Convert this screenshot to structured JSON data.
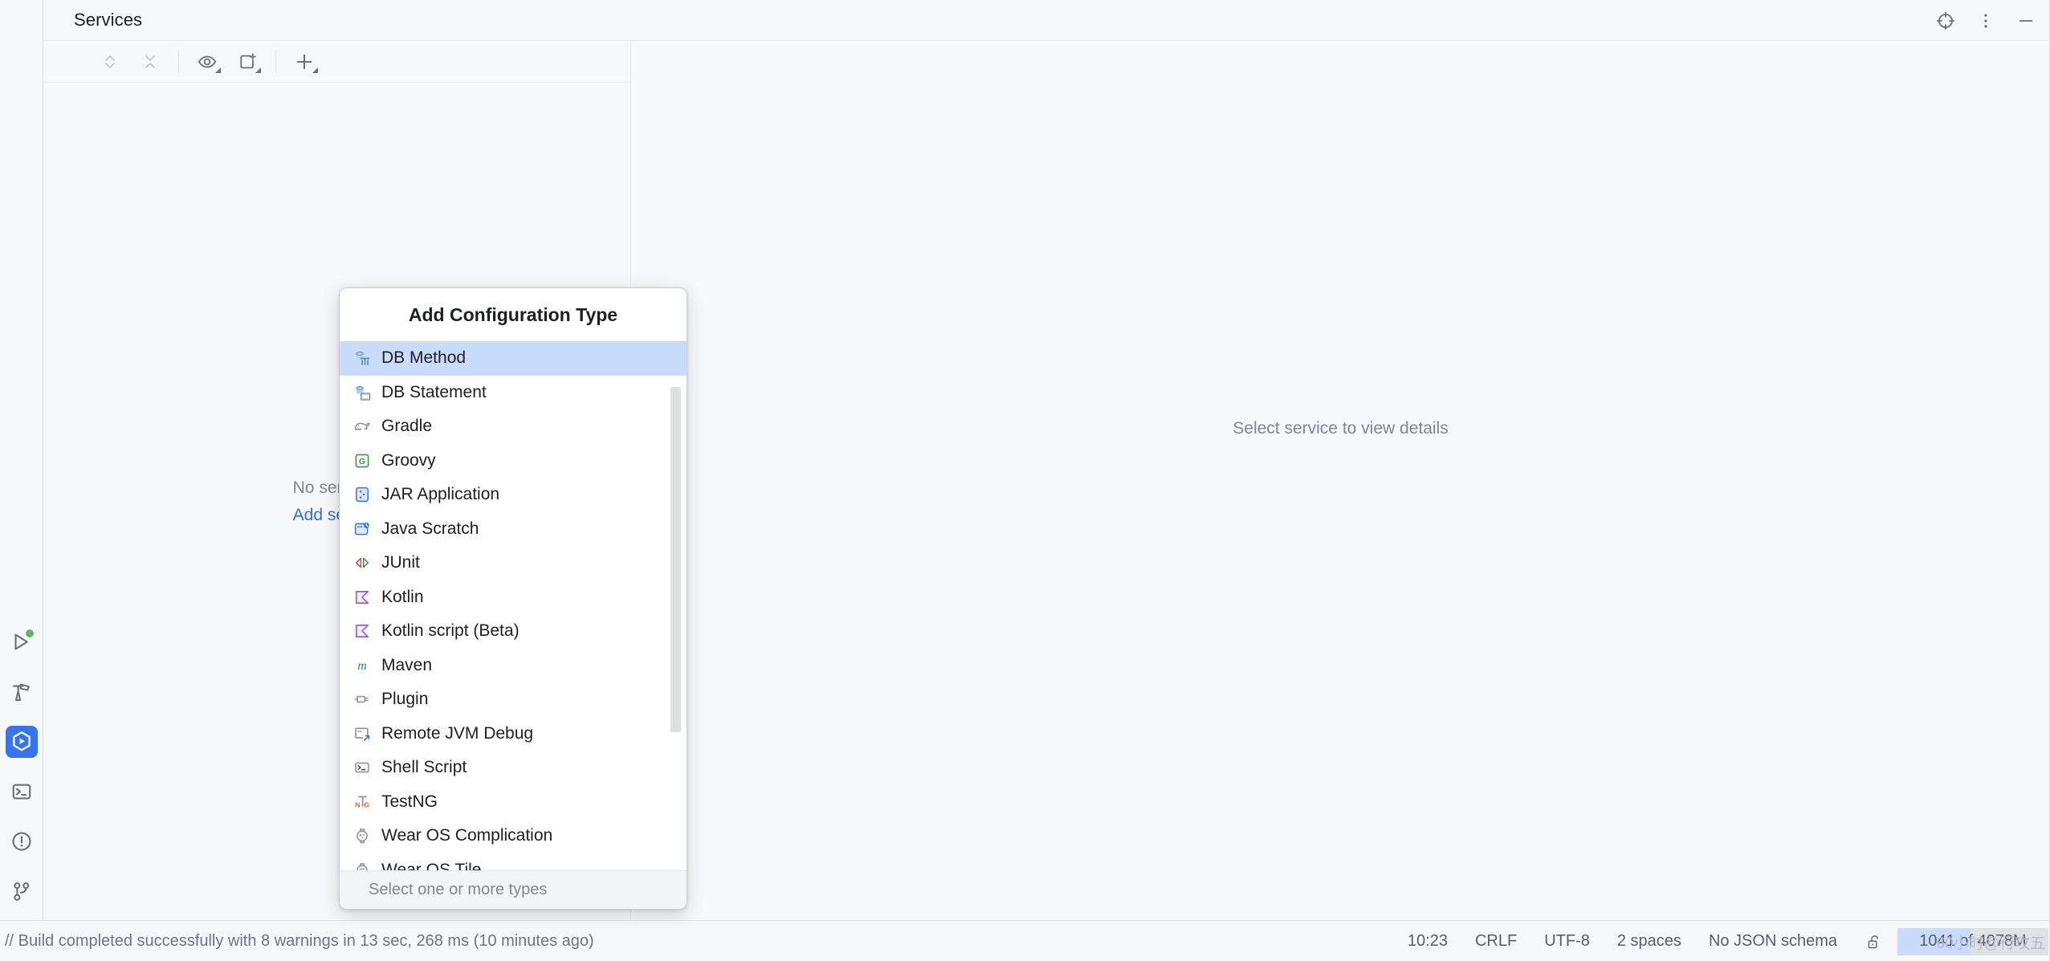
{
  "window": {
    "title": "Services",
    "header_actions": [
      {
        "name": "target-icon",
        "label": "Target"
      },
      {
        "name": "more-vertical-icon",
        "label": "Options"
      },
      {
        "name": "minimize-icon",
        "label": "Hide"
      }
    ]
  },
  "activity_bar": {
    "items": [
      {
        "name": "run-icon",
        "label": "Run",
        "selected": false,
        "badge": true
      },
      {
        "name": "build-hammer-icon",
        "label": "Build",
        "selected": false,
        "badge": false
      },
      {
        "name": "services-icon",
        "label": "Services",
        "selected": true,
        "badge": false
      },
      {
        "name": "terminal-icon",
        "label": "Terminal",
        "selected": false,
        "badge": false
      },
      {
        "name": "problems-icon",
        "label": "Problems",
        "selected": false,
        "badge": false
      },
      {
        "name": "version-control-icon",
        "label": "Version Control",
        "selected": false,
        "badge": false
      }
    ]
  },
  "left_panel": {
    "toolbar": [
      {
        "name": "expand-collapse-icon",
        "label": "Expand All",
        "dropdown": false,
        "disabled": true
      },
      {
        "name": "collapse-all-icon",
        "label": "Collapse All",
        "dropdown": false,
        "disabled": true
      },
      {
        "name": "view-options-eye-icon",
        "label": "View Options",
        "dropdown": true,
        "disabled": false
      },
      {
        "name": "add-tab-icon",
        "label": "Open in New Tab",
        "dropdown": true,
        "disabled": false
      },
      {
        "name": "add-plus-icon",
        "label": "Add Service",
        "dropdown": true,
        "disabled": false
      }
    ],
    "empty_text": "No services",
    "add_link": "Add service"
  },
  "right_panel": {
    "empty_text": "Select service to view details"
  },
  "popup": {
    "title": "Add Configuration Type",
    "footer_hint": "Select one or more types",
    "selected_index": 0,
    "items": [
      {
        "label": "DB Method",
        "icon": "db-method-icon"
      },
      {
        "label": "DB Statement",
        "icon": "db-statement-icon"
      },
      {
        "label": "Gradle",
        "icon": "gradle-elephant-icon"
      },
      {
        "label": "Groovy",
        "icon": "groovy-icon"
      },
      {
        "label": "JAR Application",
        "icon": "jar-application-icon"
      },
      {
        "label": "Java Scratch",
        "icon": "java-scratch-icon"
      },
      {
        "label": "JUnit",
        "icon": "junit-icon"
      },
      {
        "label": "Kotlin",
        "icon": "kotlin-icon"
      },
      {
        "label": "Kotlin script (Beta)",
        "icon": "kotlin-script-icon"
      },
      {
        "label": "Maven",
        "icon": "maven-icon"
      },
      {
        "label": "Plugin",
        "icon": "plugin-plug-icon"
      },
      {
        "label": "Remote JVM Debug",
        "icon": "remote-jvm-debug-icon"
      },
      {
        "label": "Shell Script",
        "icon": "shell-script-icon"
      },
      {
        "label": "TestNG",
        "icon": "testng-icon"
      },
      {
        "label": "Wear OS Complication",
        "icon": "wear-os-complication-icon"
      },
      {
        "label": "Wear OS Tile",
        "icon": "wear-os-tile-icon"
      }
    ]
  },
  "status_bar": {
    "message": "// Build completed successfully with 8 warnings in 13 sec, 268 ms (10 minutes ago)",
    "time": "10:23",
    "line_separator": "CRLF",
    "encoding": "UTF-8",
    "indent": "2 spaces",
    "schema": "No JSON schema",
    "lock": "unlock-icon",
    "memory": "1041 of 4078M",
    "watermark": "60小时@行攻五"
  },
  "colors": {
    "accent": "#3574f0",
    "selection": "#c9dcfb",
    "link": "#2f70d8",
    "muted": "#818594",
    "panel_bg": "#f7f8fa",
    "popup_bg": "#ffffff",
    "border": "#e9eaec",
    "badge_green": "#5fb865"
  }
}
